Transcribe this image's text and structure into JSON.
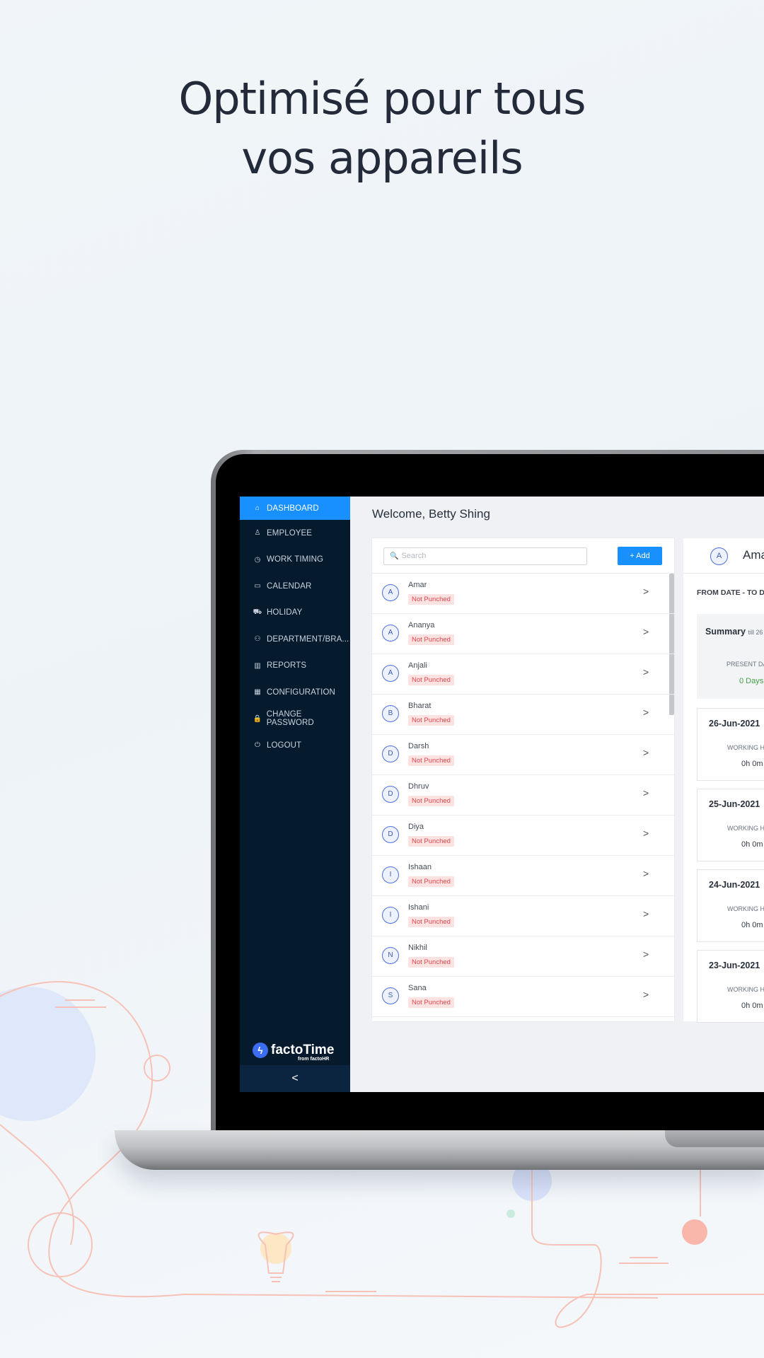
{
  "headline": {
    "line1": "Optimisé pour tous",
    "line2": "vos appareils"
  },
  "colors": {
    "accent": "#1890ff",
    "sidebar": "#061a2e",
    "badge_bg": "#fde2e2",
    "badge_text": "#e0474c",
    "present_green": "#43a047"
  },
  "sidebar": {
    "items": [
      {
        "label": "DASHBOARD",
        "icon": "home-icon",
        "glyph": "⌂",
        "active": true
      },
      {
        "label": "EMPLOYEE",
        "icon": "user-icon",
        "glyph": "♙"
      },
      {
        "label": "WORK TIMING",
        "icon": "clock-icon",
        "glyph": "◷"
      },
      {
        "label": "CALENDAR",
        "icon": "calendar-icon",
        "glyph": "▭"
      },
      {
        "label": "HOLIDAY",
        "icon": "car-icon",
        "glyph": "⛟"
      },
      {
        "label": "DEPARTMENT/BRA...",
        "icon": "team-icon",
        "glyph": "⚇"
      },
      {
        "label": "REPORTS",
        "icon": "bar-chart-icon",
        "glyph": "▥"
      },
      {
        "label": "CONFIGURATION",
        "icon": "settings-panel-icon",
        "glyph": "▦"
      },
      {
        "label": "CHANGE PASSWORD",
        "icon": "lock-icon",
        "glyph": "🔒"
      },
      {
        "label": "LOGOUT",
        "icon": "logout-icon",
        "glyph": "⏻"
      }
    ],
    "brand_name": "factoTime",
    "brand_sub": "from factoHR",
    "collapse": "<"
  },
  "main": {
    "welcome": "Welcome, Betty Shing",
    "search_placeholder": "Search",
    "add_label": "+ Add",
    "employees": [
      {
        "initial": "A",
        "name": "Amar",
        "status": "Not Punched"
      },
      {
        "initial": "A",
        "name": "Ananya",
        "status": "Not Punched"
      },
      {
        "initial": "A",
        "name": "Anjali",
        "status": "Not Punched"
      },
      {
        "initial": "B",
        "name": "Bharat",
        "status": "Not Punched"
      },
      {
        "initial": "D",
        "name": "Darsh",
        "status": "Not Punched"
      },
      {
        "initial": "D",
        "name": "Dhruv",
        "status": "Not Punched"
      },
      {
        "initial": "D",
        "name": "Diya",
        "status": "Not Punched"
      },
      {
        "initial": "I",
        "name": "Ishaan",
        "status": "Not Punched"
      },
      {
        "initial": "I",
        "name": "Ishani",
        "status": "Not Punched"
      },
      {
        "initial": "N",
        "name": "Nikhil",
        "status": "Not Punched"
      },
      {
        "initial": "S",
        "name": "Sana",
        "status": "Not Punched"
      }
    ]
  },
  "detail": {
    "initial": "A",
    "name": "Ama",
    "range_label": "FROM DATE - TO D",
    "summary_title": "Summary",
    "summary_sub": "till 26",
    "present_label": "PRESENT DA",
    "present_value": "0 Days",
    "days": [
      {
        "date": "26-Jun-2021",
        "label": "WORKING H",
        "value": "0h 0m"
      },
      {
        "date": "25-Jun-2021",
        "label": "WORKING H",
        "value": "0h 0m"
      },
      {
        "date": "24-Jun-2021",
        "label": "WORKING H",
        "value": "0h 0m"
      },
      {
        "date": "23-Jun-2021",
        "label": "WORKING H",
        "value": "0h 0m"
      }
    ]
  }
}
